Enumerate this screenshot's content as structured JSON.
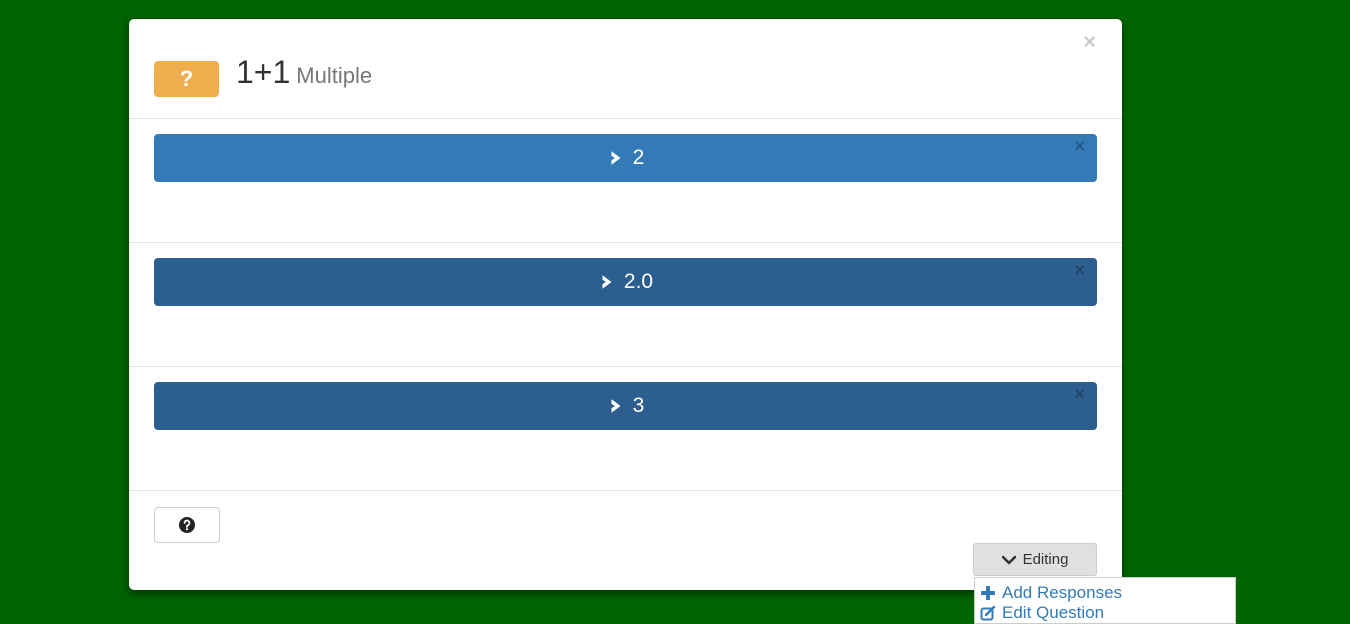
{
  "modal": {
    "close_glyph": "×",
    "badge": "?",
    "title": "1+1",
    "subtitle": "Multiple"
  },
  "responses": [
    {
      "label": "2",
      "close_glyph": "×"
    },
    {
      "label": "2.0",
      "close_glyph": "×"
    },
    {
      "label": "3",
      "close_glyph": "×"
    }
  ],
  "footer": {
    "help_icon": "question-circle-icon",
    "editing_label": "Editing"
  },
  "dropdown": {
    "items": [
      {
        "label": "Add Responses",
        "icon": "plus-icon"
      },
      {
        "label": "Edit Question",
        "icon": "edit-icon"
      }
    ]
  },
  "colors": {
    "background": "#006400",
    "badge": "#f0ad4e",
    "response_active": "#337ab7",
    "response_default": "#2c5f8f",
    "link": "#337ab7"
  }
}
